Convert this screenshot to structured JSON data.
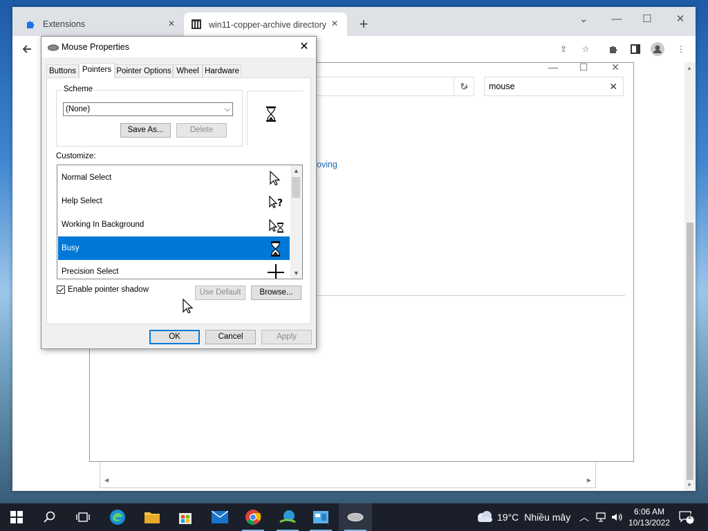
{
  "browser": {
    "tabs": [
      {
        "title": "Extensions",
        "icon": "puzzle-icon",
        "active": false
      },
      {
        "title": "win11-copper-archive directory ▯",
        "icon": "archive-icon",
        "active": true
      }
    ],
    "new_tab": "+",
    "search_value": "mouse",
    "link_fragment": "oving"
  },
  "dialog": {
    "title": "Mouse Properties",
    "tabs": [
      "Buttons",
      "Pointers",
      "Pointer Options",
      "Wheel",
      "Hardware"
    ],
    "selected_tab": "Pointers",
    "scheme_label": "Scheme",
    "scheme_value": "(None)",
    "save_as": "Save As...",
    "delete": "Delete",
    "customize_label": "Customize:",
    "pointers": [
      {
        "name": "Normal Select",
        "icon": "arrow-cursor-icon"
      },
      {
        "name": "Help Select",
        "icon": "help-cursor-icon"
      },
      {
        "name": "Working In Background",
        "icon": "working-cursor-icon"
      },
      {
        "name": "Busy",
        "icon": "hourglass-cursor-icon",
        "selected": true
      },
      {
        "name": "Precision Select",
        "icon": "crosshair-cursor-icon"
      }
    ],
    "shadow_label": "Enable pointer shadow",
    "shadow_checked": true,
    "use_default": "Use Default",
    "browse": "Browse...",
    "ok": "OK",
    "cancel": "Cancel",
    "apply": "Apply"
  },
  "taskbar": {
    "weather": "19°C",
    "weather_text": "Nhiều mây",
    "time": "6:06 AM",
    "date": "10/13/2022",
    "notifications": "2"
  }
}
